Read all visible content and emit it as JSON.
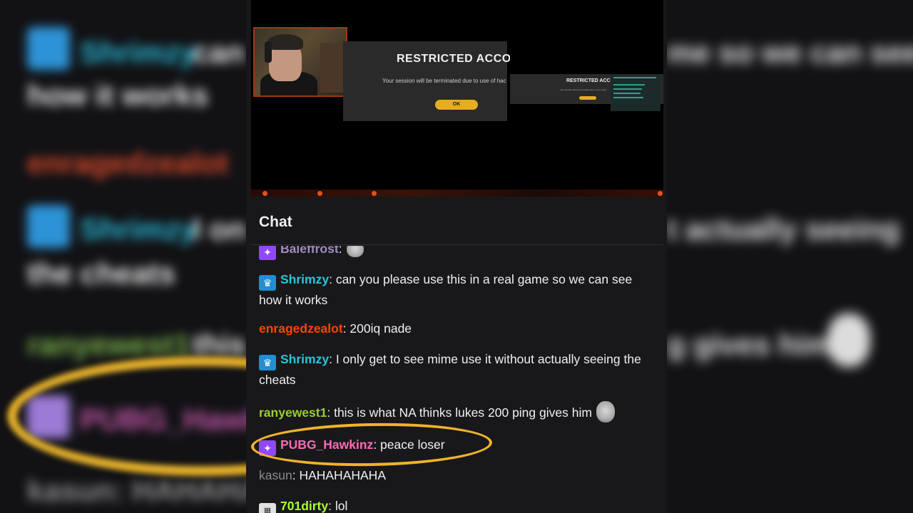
{
  "game": {
    "dialog_title": "RESTRICTED ACCOU",
    "dialog_message": "Your session will be terminated due to use of hac",
    "ok_label": "OK",
    "mini_title": "RESTRICTED ACCOUN",
    "mini_message": "Your session will be terminated due to use of hac"
  },
  "chat": {
    "title": "Chat",
    "messages": [
      {
        "user": "Baleffrost",
        "separator": ":",
        "text": "",
        "badge": "prime-icon",
        "user_color": "#a08cbe"
      },
      {
        "user": "Shrimzy",
        "separator": ":",
        "text": " can you please use this in a real game so we can see how it works",
        "badge": "crown-icon",
        "user_color": "#29c5dd"
      },
      {
        "user": "enragedzealot",
        "separator": ":",
        "text": " 200iq nade",
        "badge": "",
        "user_color": "#ff4500"
      },
      {
        "user": "Shrimzy",
        "separator": ":",
        "text": " I only get to see mime use it without actually seeing the cheats",
        "badge": "crown-icon",
        "user_color": "#29c5dd"
      },
      {
        "user": "ranyewest1",
        "separator": ":",
        "text": " this is what NA thinks lukes 200 ping gives him",
        "badge": "",
        "user_color": "#9acd32"
      },
      {
        "user": "PUBG_Hawkinz",
        "separator": ":",
        "text": " peace loser",
        "badge": "prime-icon",
        "user_color": "#ff69b4"
      },
      {
        "user": "kasun",
        "separator": ":",
        "text": " HAHAHAHAHA",
        "badge": "",
        "user_color": "#8a8a8a"
      },
      {
        "user": "701dirty",
        "separator": ":",
        "text": " lol",
        "badge": "sub-icon",
        "user_color": "#adff2f"
      }
    ]
  },
  "colors": {
    "highlight_ring": "#f0b428",
    "background": "#18181b"
  }
}
